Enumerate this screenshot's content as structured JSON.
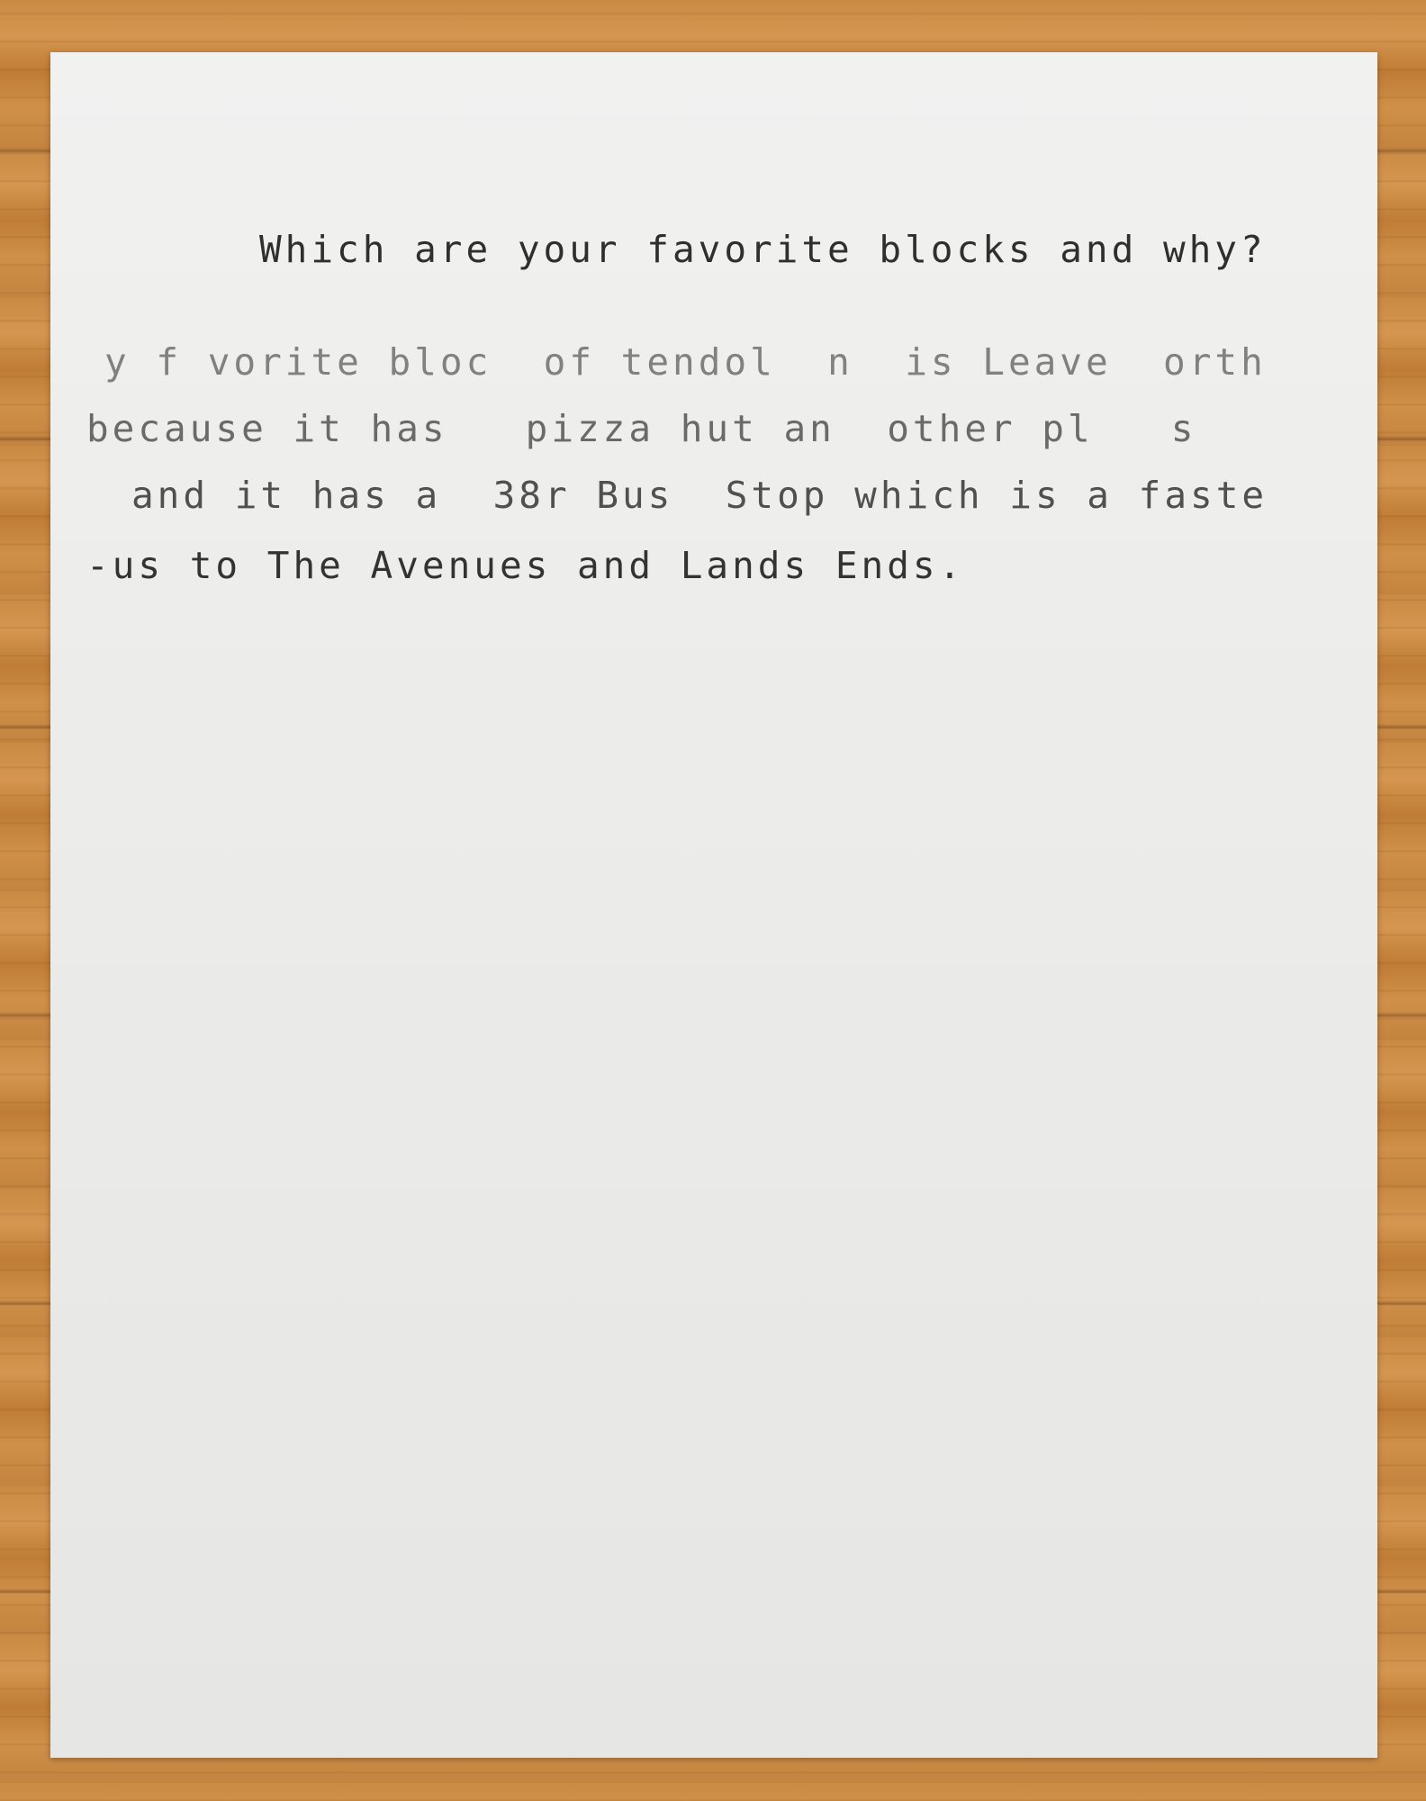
{
  "sheet": {
    "question": "Which are your favorite blocks and why?",
    "answer_lines": [
      "y f vorite bloc  of tendol  n  is Leave  orth",
      "because it has   pizza hut an  other pl   s",
      "and it has a  38r Bus  Stop which is a faste",
      "-us to The Avenues and Lands Ends."
    ]
  },
  "colors": {
    "paper": "#ececea",
    "ink": "#333333",
    "table": "#c98a44"
  }
}
